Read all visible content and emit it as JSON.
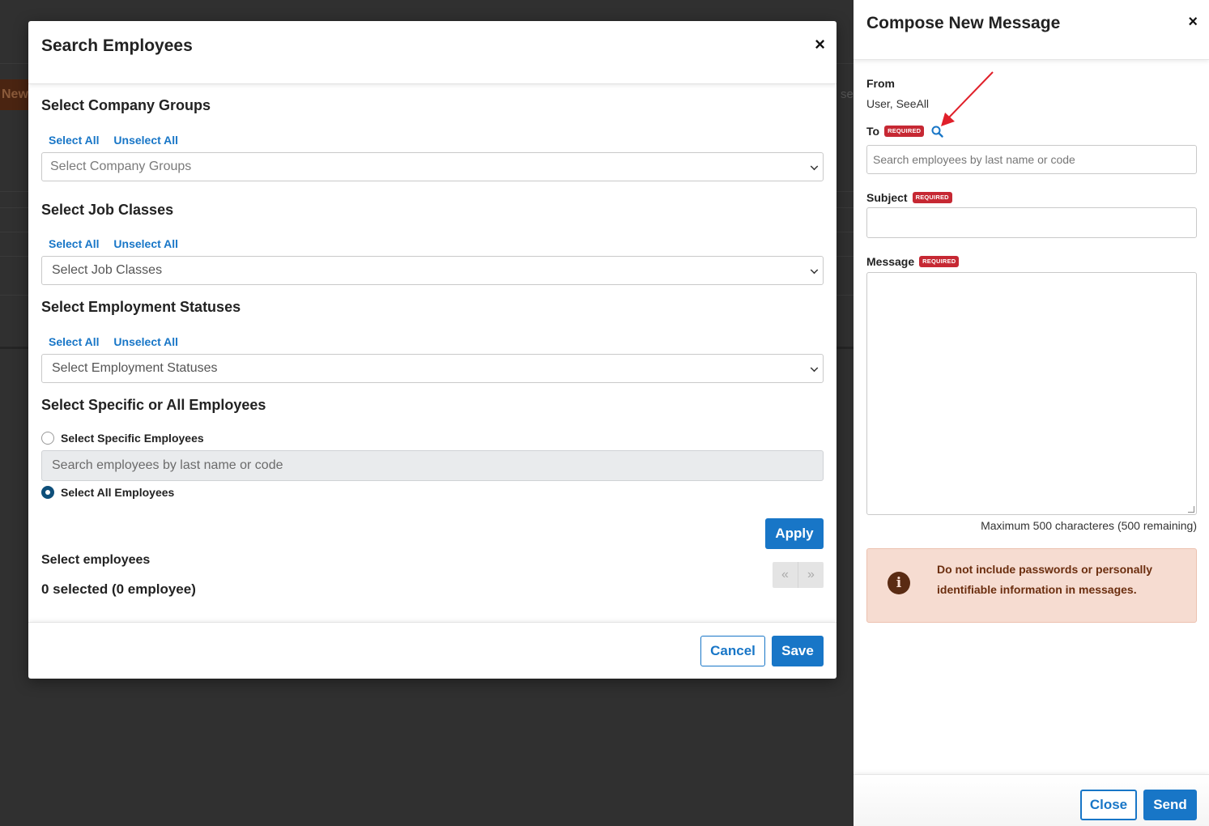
{
  "background": {
    "new_label": "New",
    "se_fragment": "se"
  },
  "search_modal": {
    "title": "Search Employees",
    "close_icon": "×",
    "company_groups": {
      "title": "Select Company Groups",
      "select_all": "Select All",
      "unselect_all": "Unselect All",
      "placeholder": "Select Company Groups"
    },
    "job_classes": {
      "title": "Select Job Classes",
      "select_all": "Select All",
      "unselect_all": "Unselect All",
      "placeholder": "Select Job Classes"
    },
    "employment_statuses": {
      "title": "Select Employment Statuses",
      "select_all": "Select All",
      "unselect_all": "Unselect All",
      "placeholder": "Select Employment Statuses"
    },
    "specific_or_all": {
      "title": "Select Specific or All Employees",
      "specific_label": "Select Specific Employees",
      "search_placeholder": "Search employees by last name or code",
      "all_label": "Select All Employees",
      "selected_option": "all"
    },
    "apply_label": "Apply",
    "select_employees_label": "Select employees",
    "selected_count": "0 selected (0 employee)",
    "pager": {
      "prev": "«",
      "next": "»"
    },
    "cancel_label": "Cancel",
    "save_label": "Save"
  },
  "compose_panel": {
    "title": "Compose New Message",
    "close_icon": "×",
    "from_label": "From",
    "from_value": "User, SeeAll",
    "to_label": "To",
    "required_badge": "REQUIRED",
    "to_placeholder": "Search employees by last name or code",
    "subject_label": "Subject",
    "subject_value": "",
    "message_label": "Message",
    "message_value": "",
    "char_hint": "Maximum 500 characteres (500 remaining)",
    "alert_text": "Do not include passwords or personally identifiable information in messages.",
    "close_label": "Close",
    "send_label": "Send"
  },
  "colors": {
    "accent": "#1876c7",
    "required": "#c62833",
    "alert_bg": "#f6dcd1",
    "alert_text": "#6b2e0f",
    "annotation_arrow": "#e0202a"
  }
}
